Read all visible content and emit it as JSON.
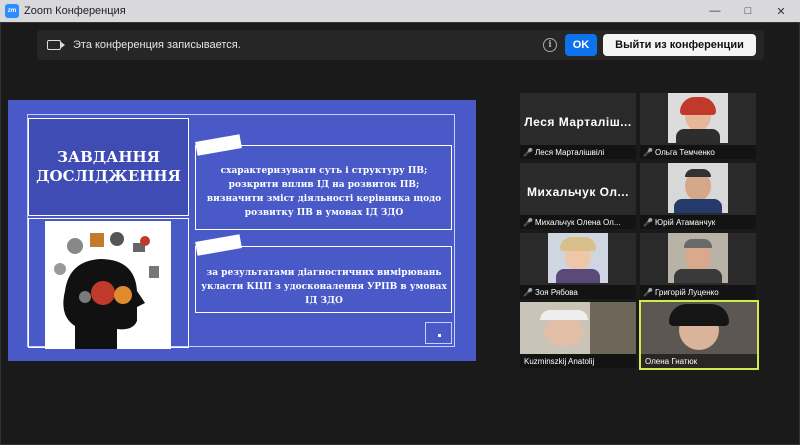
{
  "window": {
    "title": "Zoom Конференция"
  },
  "recording_bar": {
    "text": "Эта конференция записывается.",
    "ok_label": "OK",
    "leave_label": "Выйти из конференции"
  },
  "slide": {
    "title": "ЗАВДАННЯ ДОСЛІДЖЕННЯ",
    "task1": "схарактеризувати суть і структуру ПВ; розкрити вплив ІД на розвиток ПВ; визначити зміст діяльності керівника щодо розвитку ПВ в умовах ІД ЗДО",
    "task2": "за результатами діагностичних вимірювань укласти КЦП з удосконалення УРПВ в умовах ІД ЗДО"
  },
  "participants": [
    {
      "display_name": "Леся Марталіш...",
      "name": "Леся Марталішвілі",
      "video": false,
      "muted": true
    },
    {
      "display_name": "",
      "name": "Ольга Темченко",
      "video": true,
      "muted": true
    },
    {
      "display_name": "Михальчук Ол...",
      "name": "Михальчук Олена Ол...",
      "video": false,
      "muted": true
    },
    {
      "display_name": "",
      "name": "Юрій Атаманчук",
      "video": true,
      "muted": true
    },
    {
      "display_name": "",
      "name": "Зоя Рябова",
      "video": true,
      "muted": true
    },
    {
      "display_name": "",
      "name": "Григорій Луценко",
      "video": true,
      "muted": true
    },
    {
      "display_name": "",
      "name": "Kuzminszkij Anatolij",
      "video": true,
      "muted": false
    },
    {
      "display_name": "",
      "name": "Олена Гнатюк",
      "video": true,
      "muted": false,
      "active_speaker": true
    }
  ],
  "colors": {
    "accent": "#0e72ed",
    "slide_bg": "#4a59c8",
    "active_border": "#d4e94b",
    "muted_icon": "#e02828"
  },
  "icons": {
    "app": "zoom-icon",
    "record": "recording-icon",
    "info": "info-icon",
    "mic_muted": "mic-muted-icon"
  }
}
